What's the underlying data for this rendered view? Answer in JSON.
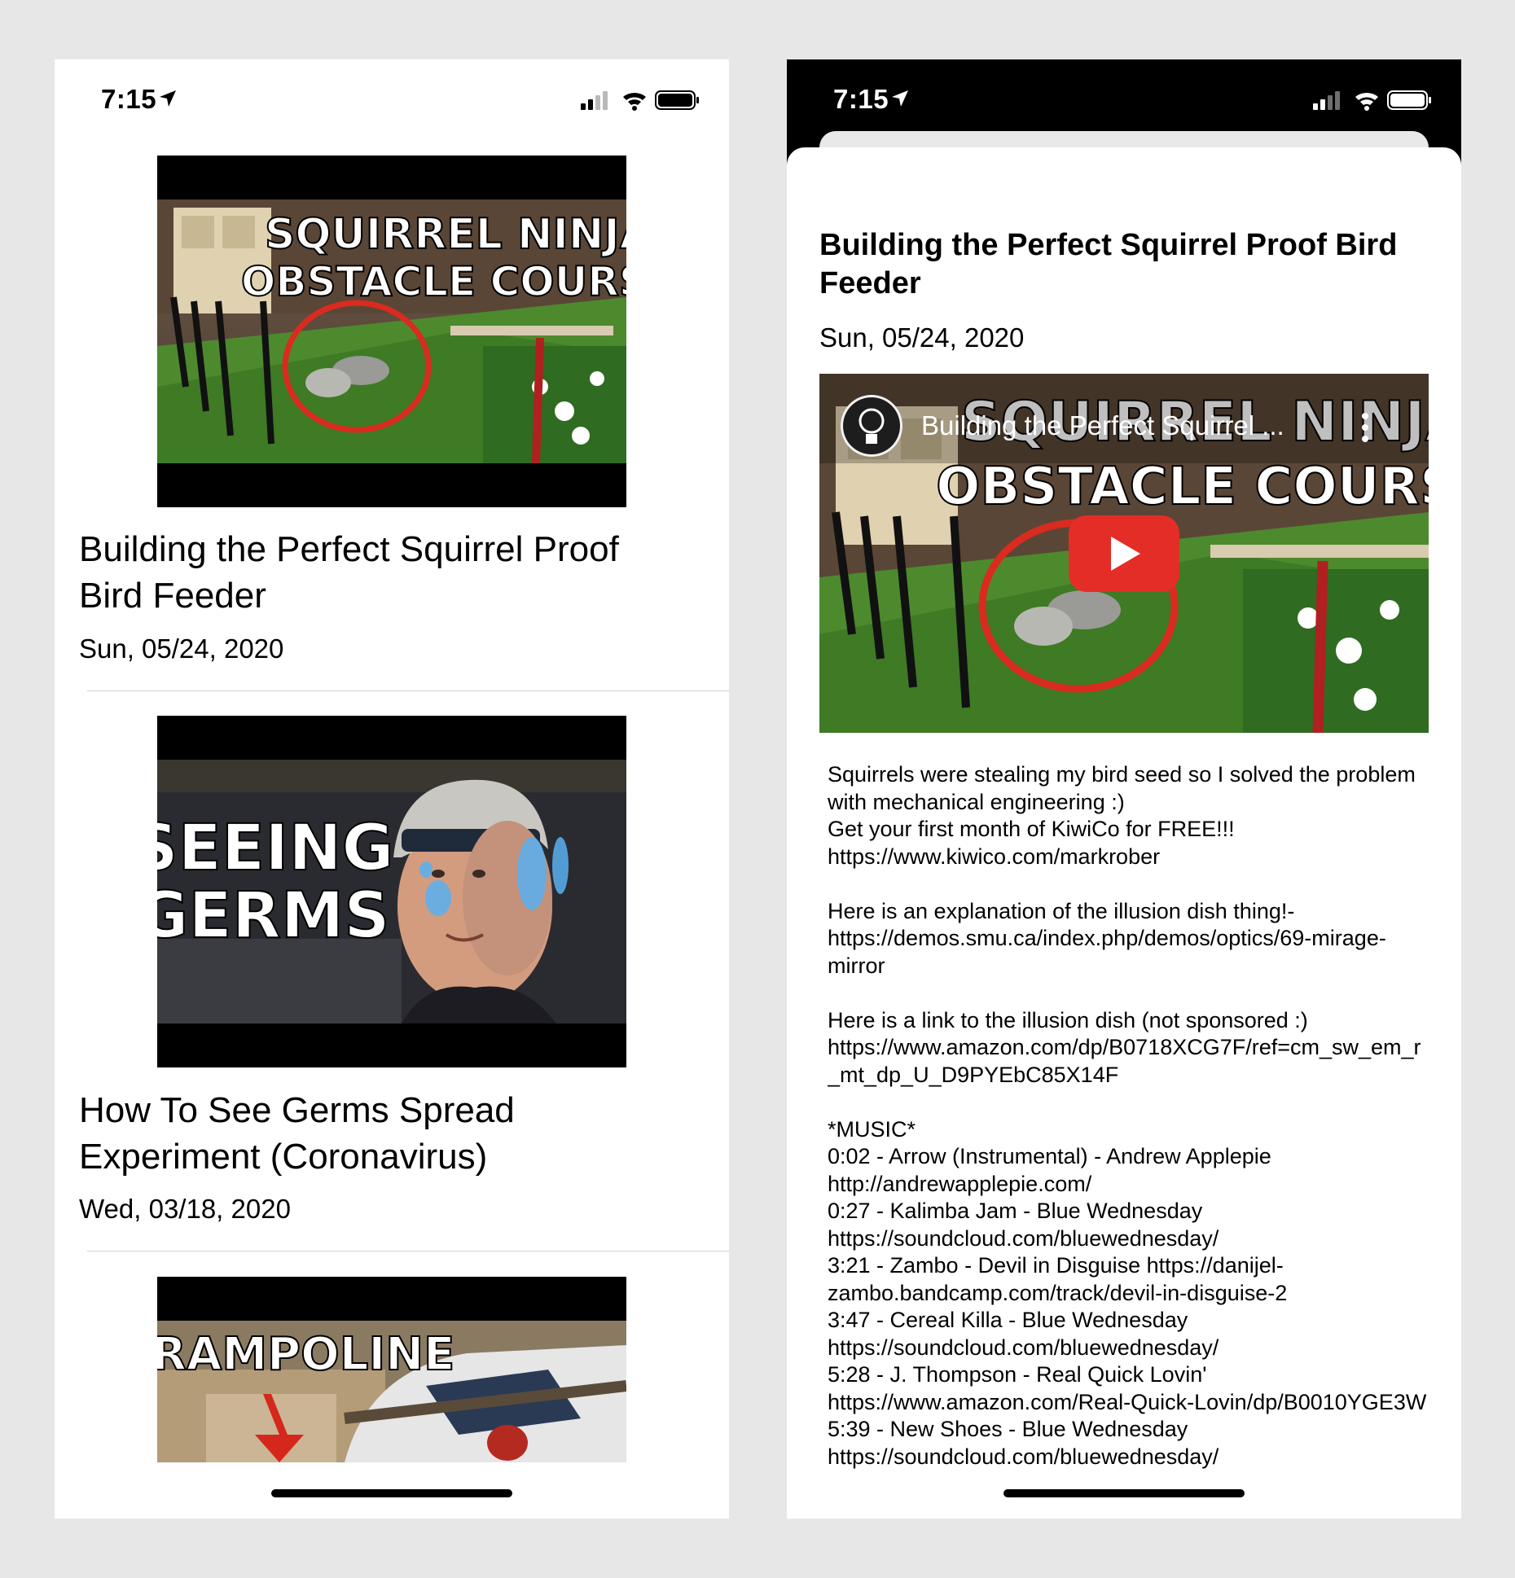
{
  "status_bar": {
    "time": "7:15"
  },
  "feed": {
    "items": [
      {
        "thumb_title_line1": "SQUIRREL NINJA",
        "thumb_title_line2": "OBSTACLE COURSE",
        "title": "Building the Perfect Squirrel Proof Bird Feeder",
        "date": "Sun, 05/24, 2020"
      },
      {
        "thumb_title_line1": "SEEING",
        "thumb_title_line2": "GERMS",
        "title": "How To See Germs Spread Experiment (Coronavirus)",
        "date": "Wed, 03/18, 2020"
      },
      {
        "thumb_title_line1": "TRAMPOLINE",
        "thumb_title_line2": ""
      }
    ]
  },
  "detail": {
    "title": "Building the Perfect Squirrel Proof Bird Feeder",
    "date": "Sun, 05/24, 2020",
    "player": {
      "overlay_title": "Building the Perfect Squirrel ...",
      "thumb_title_line1": "SQUIRREL NINJA",
      "thumb_title_line2": "OBSTACLE COURSE"
    },
    "description": "Squirrels were stealing my bird seed so I solved the problem with mechanical engineering :)\nGet your first month of KiwiCo for FREE!!! https://www.kiwico.com/markrober\n\nHere is an explanation of the illusion dish thing!- https://demos.smu.ca/index.php/demos/optics/69-mirage-mirror\n\nHere is a link to the illusion dish (not sponsored :)\nhttps://www.amazon.com/dp/B0718XCG7F/ref=cm_sw_em_r_mt_dp_U_D9PYEbC85X14F\n\n*MUSIC*\n0:02 - Arrow (Instrumental) - Andrew Applepie http://andrewapplepie.com/\n0:27 - Kalimba Jam - Blue Wednesday https://soundcloud.com/bluewednesday/\n3:21 - Zambo - Devil in Disguise https://danijel-zambo.bandcamp.com/track/devil-in-disguise-2\n3:47 - Cereal Killa - Blue Wednesday https://soundcloud.com/bluewednesday/\n5:28 - J. Thompson - Real Quick Lovin' https://www.amazon.com/Real-Quick-Lovin/dp/B0010YGE3W\n5:39 - New Shoes - Blue Wednesday https://soundcloud.com/bluewednesday/"
  },
  "colors": {
    "youtube_red": "#e52d27",
    "thumb_text": "#ffffff",
    "circle_red": "#d92b1f"
  },
  "icons": [
    "location-arrow-icon",
    "cellular-signal-icon",
    "wifi-icon",
    "battery-icon",
    "play-icon",
    "more-vert-icon",
    "channel-logo-icon"
  ]
}
